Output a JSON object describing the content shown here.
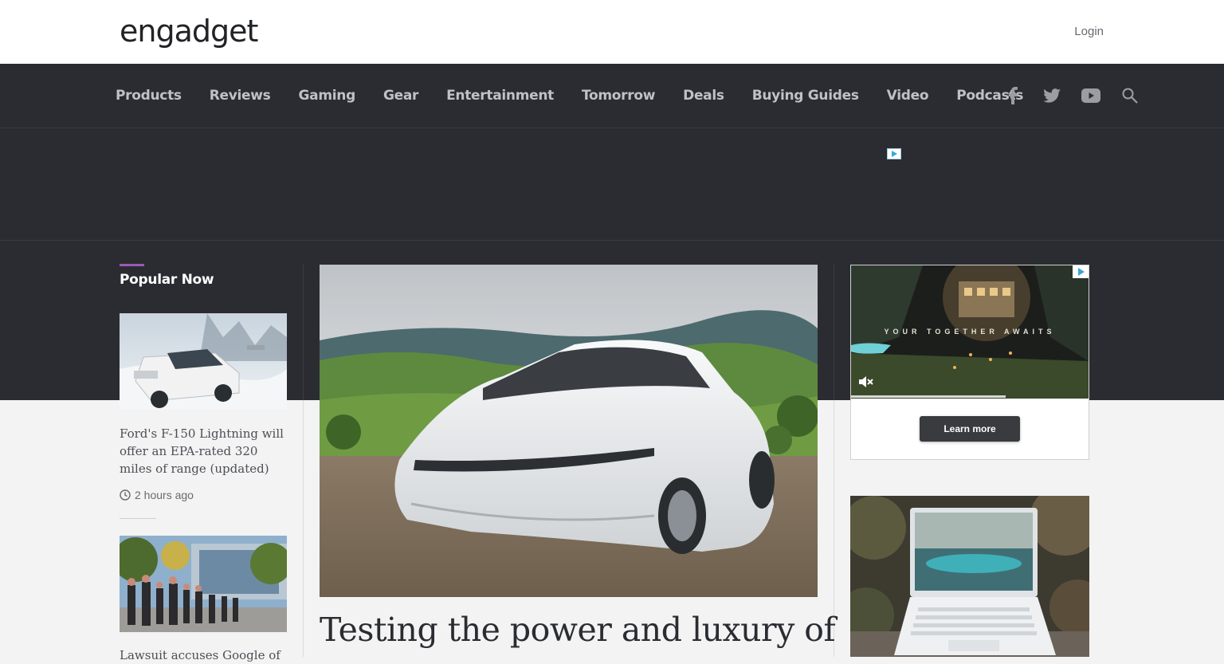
{
  "header": {
    "logo": "engadget",
    "login_label": "Login"
  },
  "nav": {
    "items": [
      "Products",
      "Reviews",
      "Gaming",
      "Gear",
      "Entertainment",
      "Tomorrow",
      "Deals",
      "Buying Guides",
      "Video",
      "Podcasts"
    ],
    "icons": [
      "facebook-icon",
      "twitter-icon",
      "youtube-icon",
      "search-icon"
    ]
  },
  "popular": {
    "title": "Popular Now",
    "articles": [
      {
        "headline": "Ford's F-150 Lightning will offer an EPA-rated 320 miles of range (updated)",
        "time": "2 hours ago"
      },
      {
        "headline": "Lawsuit accuses Google of"
      }
    ]
  },
  "featured": {
    "headline": "Testing the power and luxury of"
  },
  "sidebar_ad": {
    "tagline": "YOUR TOGETHER AWAITS",
    "cta_label": "Learn more",
    "progress": 0.65
  },
  "colors": {
    "dark_bg": "#2b2c31",
    "nav_text": "#bfc1c6",
    "accent": "#9b59b6",
    "page_bg": "#f3f3f3"
  }
}
